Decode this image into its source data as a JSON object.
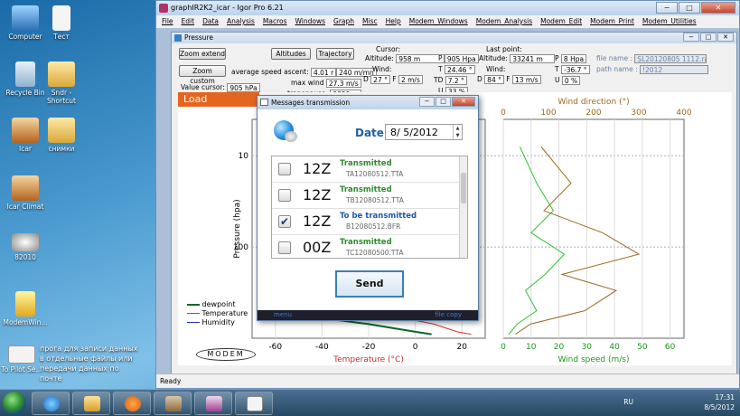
{
  "desktop": {
    "icons": [
      "Computer",
      "Тест",
      "Recycle Bin",
      "Sndr - Shortcut",
      "Icar",
      "снимки",
      "Icar Climat",
      "82010",
      "ModemWin...",
      "To Pilot Se..."
    ],
    "note": "прога для записи данных в отдельные файлы или передачи данных по почте"
  },
  "main_window": {
    "title": "graphIR2K2_icar - Igor Pro 6.21",
    "controls": [
      "−",
      "□",
      "✕"
    ],
    "menu": [
      "File",
      "Edit",
      "Data",
      "Analysis",
      "Macros",
      "Windows",
      "Graph",
      "Misc",
      "Help",
      "Modem_Windows",
      "Modem_Analysis",
      "Modem_Edit",
      "Modem_Print",
      "Modem_Utilities"
    ],
    "status": "Ready"
  },
  "pressure_window": {
    "title": "Pressure",
    "buttons": {
      "zoom_extend": "Zoom extend",
      "zoom_custom": "Zoom custom",
      "altitudes": "Altitudes",
      "trajectory": "Trajectory"
    },
    "value_cursor_label": "Value cursor:",
    "value_cursor_value": "905 hPa",
    "avg_speed_label": "average speed ascent:",
    "avg_speed_value1": "4.01 r",
    "avg_speed_value2": "240 m/mn",
    "max_wind_label": "max wind",
    "max_wind_value": "27.3 m/s",
    "tropopause_label": "tropopause:",
    "tropopause_value": "9829 m",
    "cursor_label": "Cursor:",
    "cursor_altitude_label": "Altitude:",
    "cursor_altitude_value": "958 m",
    "cursor_wind_label": "Wind:",
    "cursor_d_label": "D",
    "cursor_d_value": "27 °",
    "cursor_f_label": "F",
    "cursor_f_value": "2 m/s",
    "cursor_p_label": "P",
    "cursor_p_value": "905 Hpa",
    "cursor_t_label": "T",
    "cursor_t_value": "24.46 °",
    "cursor_td_label": "TD",
    "cursor_td_value": "7.2 °",
    "cursor_u_label": "U",
    "cursor_u_value": "33 %",
    "last_point_label": "Last point:",
    "last_altitude_label": "Altitude:",
    "last_altitude_value": "33241 m",
    "last_wind_label": "Wind:",
    "last_d_label": "D",
    "last_d_value": "84 °",
    "last_f_label": "F",
    "last_f_value": "13 m/s",
    "last_p_label": "P",
    "last_p_value": "8 Hpa",
    "last_t_label": "T",
    "last_t_value": "-36.7 °",
    "last_u_label": "U",
    "last_u_value": "0 %",
    "file_name_label": "file name :",
    "file_name_value": "SL20120805 1112.ra",
    "path_name_label": "path name :",
    "path_name_value": "!2012",
    "load_button": "Load Data/Mess"
  },
  "graph": {
    "top_axis_title": "Wind direction (°)",
    "bottom_axis_temp": "Temperature (°C)",
    "bottom_axis_wind": "Wind speed (m/s)",
    "left_axis": "Pressure (hpa)",
    "legend": [
      "dewpoint",
      "Temperature",
      "Humidity"
    ],
    "logo": "MODEM",
    "colors": {
      "dewpoint": "#0a6a2a",
      "temperature": "#d83030",
      "humidity": "#2030b0",
      "wind_speed": "#30c030",
      "wind_dir": "#9a6a20"
    }
  },
  "chart_data": [
    {
      "type": "line",
      "title": "",
      "xlabel": "Temperature (°C)",
      "ylabel": "Pressure (hpa)",
      "x_ticks": [
        -60,
        -40,
        -20,
        0,
        20
      ],
      "y_ticks": [
        10,
        100
      ],
      "ylim": [
        1000,
        4
      ],
      "yscale": "log",
      "series": [
        {
          "name": "Temperature",
          "x": [
            24,
            18,
            8,
            -5
          ],
          "y": [
            905,
            850,
            700,
            600
          ]
        },
        {
          "name": "dewpoint",
          "x": [
            7,
            0,
            -20,
            -40
          ],
          "y": [
            905,
            850,
            700,
            600
          ]
        }
      ]
    },
    {
      "type": "line",
      "title": "",
      "xlabel": "Wind speed (m/s)",
      "x_ticks": [
        0,
        10,
        20,
        30,
        40,
        50,
        60
      ],
      "x2label": "Wind direction (°)",
      "x2_ticks": [
        0,
        100,
        200,
        300,
        400
      ],
      "series": [
        {
          "name": "Wind speed",
          "x": [
            2,
            5,
            12,
            8,
            15,
            22,
            10,
            18,
            12,
            6
          ],
          "y": [
            905,
            700,
            500,
            300,
            200,
            120,
            70,
            40,
            20,
            8
          ]
        },
        {
          "name": "Wind direction",
          "x": [
            27,
            60,
            180,
            250,
            130,
            300,
            220,
            90,
            150,
            84
          ],
          "y": [
            905,
            700,
            500,
            300,
            200,
            120,
            70,
            40,
            20,
            8
          ]
        }
      ]
    }
  ],
  "dialog": {
    "title": "Messages transmission",
    "date_label": "Date",
    "date_value": "8/ 5/2012",
    "spin_up": "▲",
    "spin_down": "▼",
    "rows": [
      {
        "time": "12Z",
        "status": "Transmitted",
        "file": "TA12080512.TTA",
        "checked": false
      },
      {
        "time": "12Z",
        "status": "Transmitted",
        "file": "TB12080512.TTA",
        "checked": false
      },
      {
        "time": "12Z",
        "status": "To be transmitted",
        "file": "B12080512.BFR",
        "checked": true
      },
      {
        "time": "00Z",
        "status": "Transmitted",
        "file": "TC12080500.TTA",
        "checked": false
      }
    ],
    "check_mark": "✔",
    "send_label": "Send",
    "footer_left": "menu",
    "footer_right": "file copy",
    "status_colors": {
      "Transmitted": "#2e8b2e",
      "To be transmitted": "#1f58a8"
    }
  },
  "taskbar": {
    "lang": "RU",
    "time": "17:31",
    "date": "8/5/2012"
  }
}
